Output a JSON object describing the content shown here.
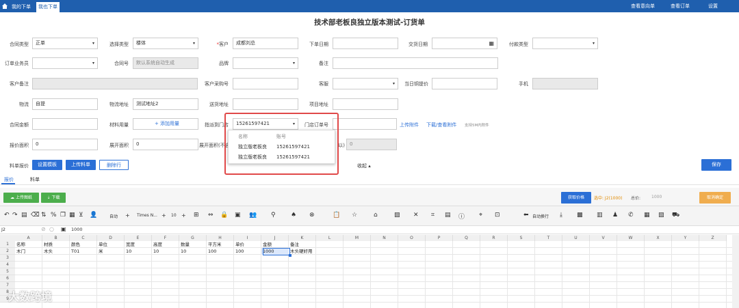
{
  "nav": {
    "tabs": [
      "我的下单",
      "我也下单"
    ],
    "right": [
      "查看意向单",
      "查看订单",
      "设置"
    ]
  },
  "title": "技术部老板良独立版本测试-订货单",
  "form": {
    "contract_type_label": "合同类型",
    "contract_type_value": "正单",
    "select_type_label": "选择类型",
    "select_type_value": "楼体",
    "customer_label": "客户",
    "customer_value": "成都刘总",
    "order_date_label": "下单日期",
    "delivery_date_label": "交货日期",
    "payment_type_label": "付款类型",
    "salesman_label": "订单业务员",
    "contract_no_label": "合同号",
    "contract_no_placeholder": "默认系统自动生成",
    "brand_label": "品牌",
    "remark_label": "备注",
    "customer_remark_label": "客户备注",
    "customer_po_label": "客户采购号",
    "service_label": "客服",
    "daily_price_label": "当日铜提价",
    "phone_label": "手机",
    "logistics_label": "物流",
    "logistics_value": "自提",
    "logistics_addr_label": "物流地址",
    "logistics_addr_value": "测试地址2",
    "delivery_addr_label": "送货地址",
    "project_addr_label": "项目地址",
    "contract_amount_label": "合同金额",
    "material_usage_label": "材料用量",
    "add_usage_link": "+ 添加用量",
    "assign_label": "指派到门店",
    "assign_value": "15261597421",
    "shop_order_label": "门店订单号",
    "upload_attach_link": "上传附件",
    "download_attach_link": "下载/查看附件",
    "attach_hint": "支持5M内附件",
    "report_area_label": "报价面积",
    "report_area_value": "0",
    "expand_area_label": "展开面积",
    "expand_area_value": "0",
    "expand_area2_label": "展开面积(不含",
    "right_zero_value": "0",
    "hidden_partial_label": "以)",
    "material_quote_label": "料单报价",
    "set_template_btn": "设置模板",
    "upload_material_btn": "上传料单",
    "delete_row_btn": "删除行",
    "collapse_text": "收起 ▴",
    "save_btn": "保存"
  },
  "popup": {
    "col1": "名称",
    "col2": "账号",
    "rows": [
      {
        "name": "独立版老板良",
        "account": "15261597421"
      },
      {
        "name": "独立版老板良",
        "account": "15261597421"
      }
    ]
  },
  "tabs": [
    "报价",
    "料单"
  ],
  "sheet_bar": {
    "upload_drawing": "☁ 上传图纸",
    "download": "⇣ 下载",
    "fetch_price": "获取价格",
    "selected_text": "选中: J2(1000)",
    "total_label": "总价:",
    "total_value": "1000",
    "cancel_confirm": "取消确定"
  },
  "toolbar": {
    "auto": "自动",
    "font_name": "Times N...",
    "font_size": "10",
    "wrap": "自动换行",
    "merge": "合并"
  },
  "formula": {
    "cell_ref": "J2",
    "value": "1000"
  },
  "sheet": {
    "columns": [
      "A",
      "B",
      "C",
      "D",
      "E",
      "F",
      "G",
      "H",
      "I",
      "J",
      "K",
      "L",
      "M",
      "N",
      "O",
      "P",
      "Q",
      "R",
      "S",
      "T",
      "U",
      "V",
      "W",
      "X",
      "Y",
      "Z"
    ],
    "row_numbers": [
      "1",
      "2",
      "3",
      "4",
      "5",
      "6",
      "7",
      "8",
      "9"
    ],
    "header_row": [
      "名称",
      "材质",
      "颜色",
      "单位",
      "宽度",
      "高度",
      "数量",
      "平方米",
      "单价",
      "金额",
      "备注"
    ],
    "data_row": [
      "木门",
      "木头",
      "T01",
      "米",
      "10",
      "10",
      "10",
      "100",
      "100",
      "1000",
      "木头硬好用"
    ]
  },
  "watermark": "大数跨境",
  "colors": {
    "nav_blue": "#1f5fae",
    "accent_blue": "#2b6fd6",
    "green": "#4cae4c",
    "orange": "#f0ad4e",
    "red_frame": "#e04848"
  }
}
